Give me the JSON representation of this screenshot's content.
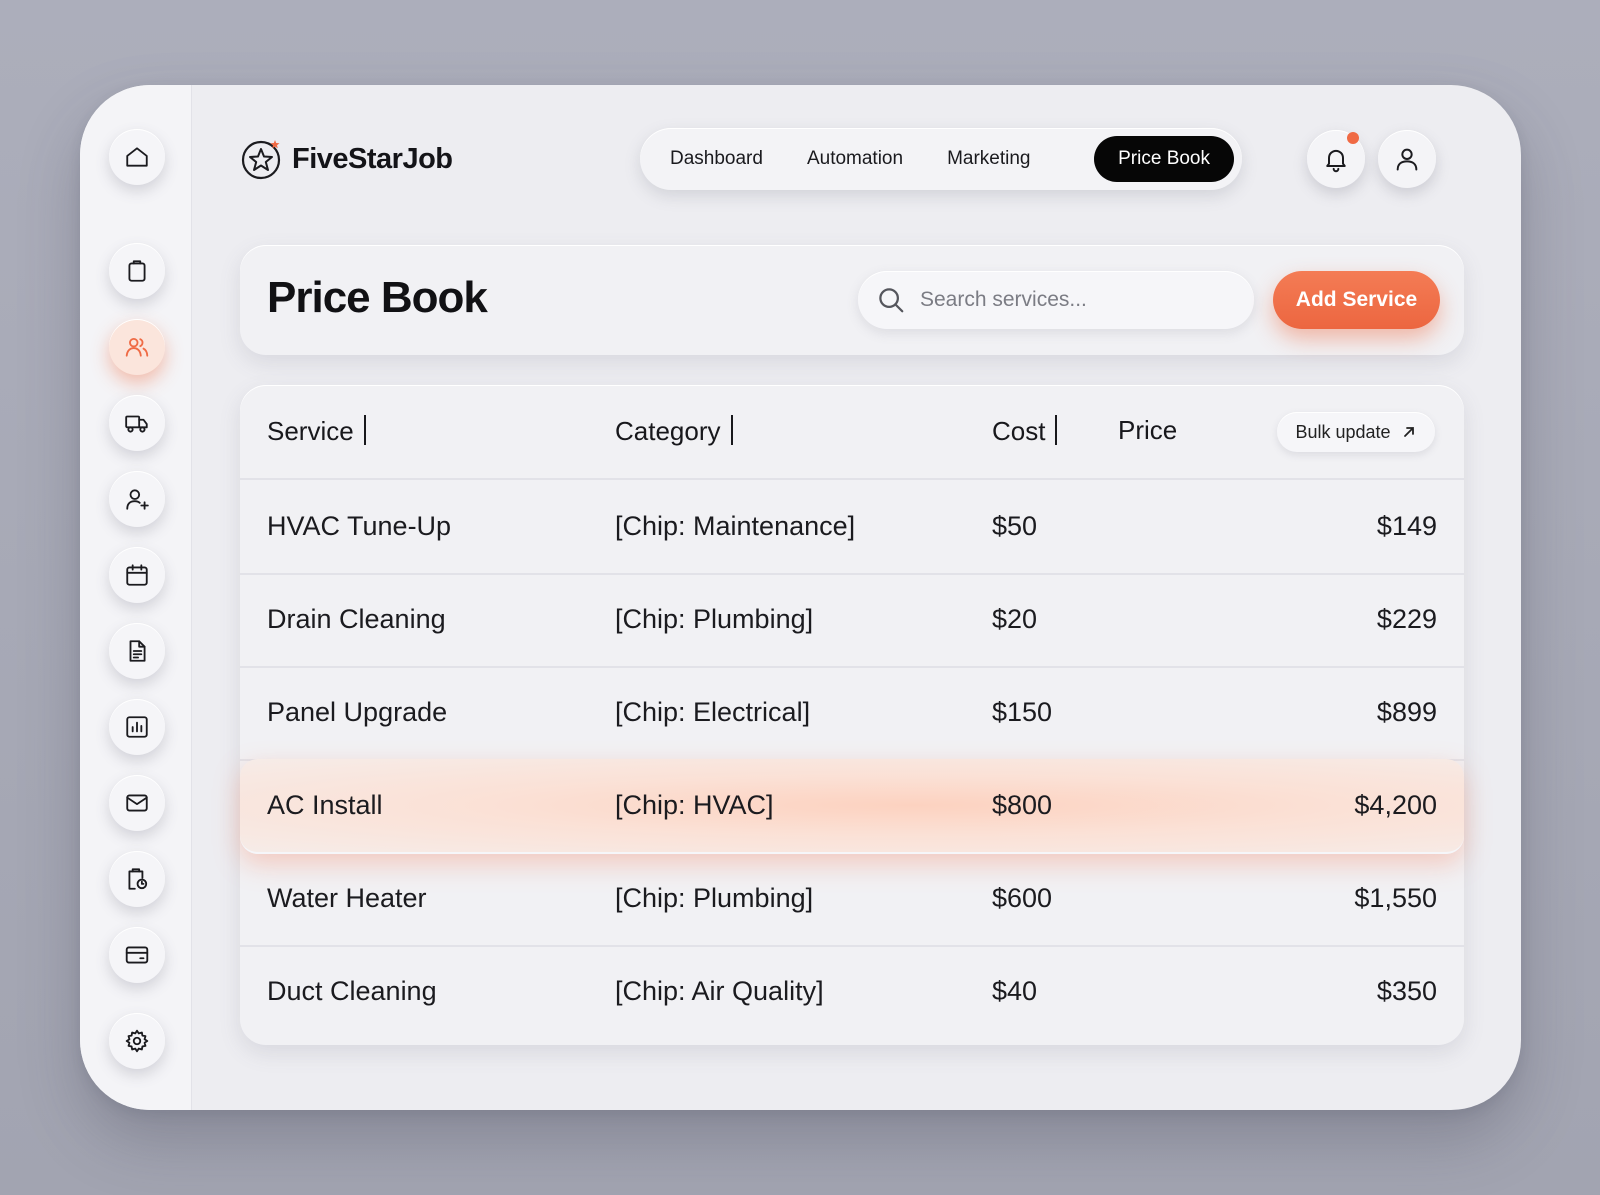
{
  "app": {
    "name": "FiveStarJob",
    "accent": "#ef6b45"
  },
  "sidebar": {
    "items": [
      {
        "icon": "home-icon"
      },
      {
        "icon": "clipboard-icon"
      },
      {
        "icon": "users-icon",
        "active": true
      },
      {
        "icon": "truck-icon"
      },
      {
        "icon": "user-plus-icon"
      },
      {
        "icon": "calendar-icon"
      },
      {
        "icon": "document-icon"
      },
      {
        "icon": "chart-icon"
      },
      {
        "icon": "mail-icon"
      },
      {
        "icon": "clipboard-clock-icon"
      },
      {
        "icon": "credit-card-icon"
      },
      {
        "icon": "gear-icon"
      }
    ]
  },
  "nav": {
    "tabs": [
      {
        "label": "Dashboard"
      },
      {
        "label": "Automation"
      },
      {
        "label": "Marketing"
      },
      {
        "label": "Price Book",
        "active": true
      }
    ]
  },
  "header": {
    "title": "Price Book",
    "search_placeholder": "Search services...",
    "add_label": "Add Service"
  },
  "table": {
    "columns": [
      "Service",
      "Category",
      "Cost",
      "Price"
    ],
    "bulk_label": "Bulk update",
    "rows": [
      {
        "service": "HVAC Tune-Up",
        "category": "[Chip: Maintenance]",
        "cost": "$50",
        "price": "$149"
      },
      {
        "service": "Drain Cleaning",
        "category": "[Chip: Plumbing]",
        "cost": "$20",
        "price": "$229"
      },
      {
        "service": "Panel Upgrade",
        "category": "[Chip: Electrical]",
        "cost": "$150",
        "price": "$899"
      },
      {
        "service": "AC Install",
        "category": "[Chip: HVAC]",
        "cost": "$800",
        "price": "$4,200",
        "highlighted": true
      },
      {
        "service": "Water Heater",
        "category": "[Chip: Plumbing]",
        "cost": "$600",
        "price": "$1,550"
      },
      {
        "service": "Duct Cleaning",
        "category": "[Chip: Air Quality]",
        "cost": "$40",
        "price": "$350"
      }
    ]
  }
}
